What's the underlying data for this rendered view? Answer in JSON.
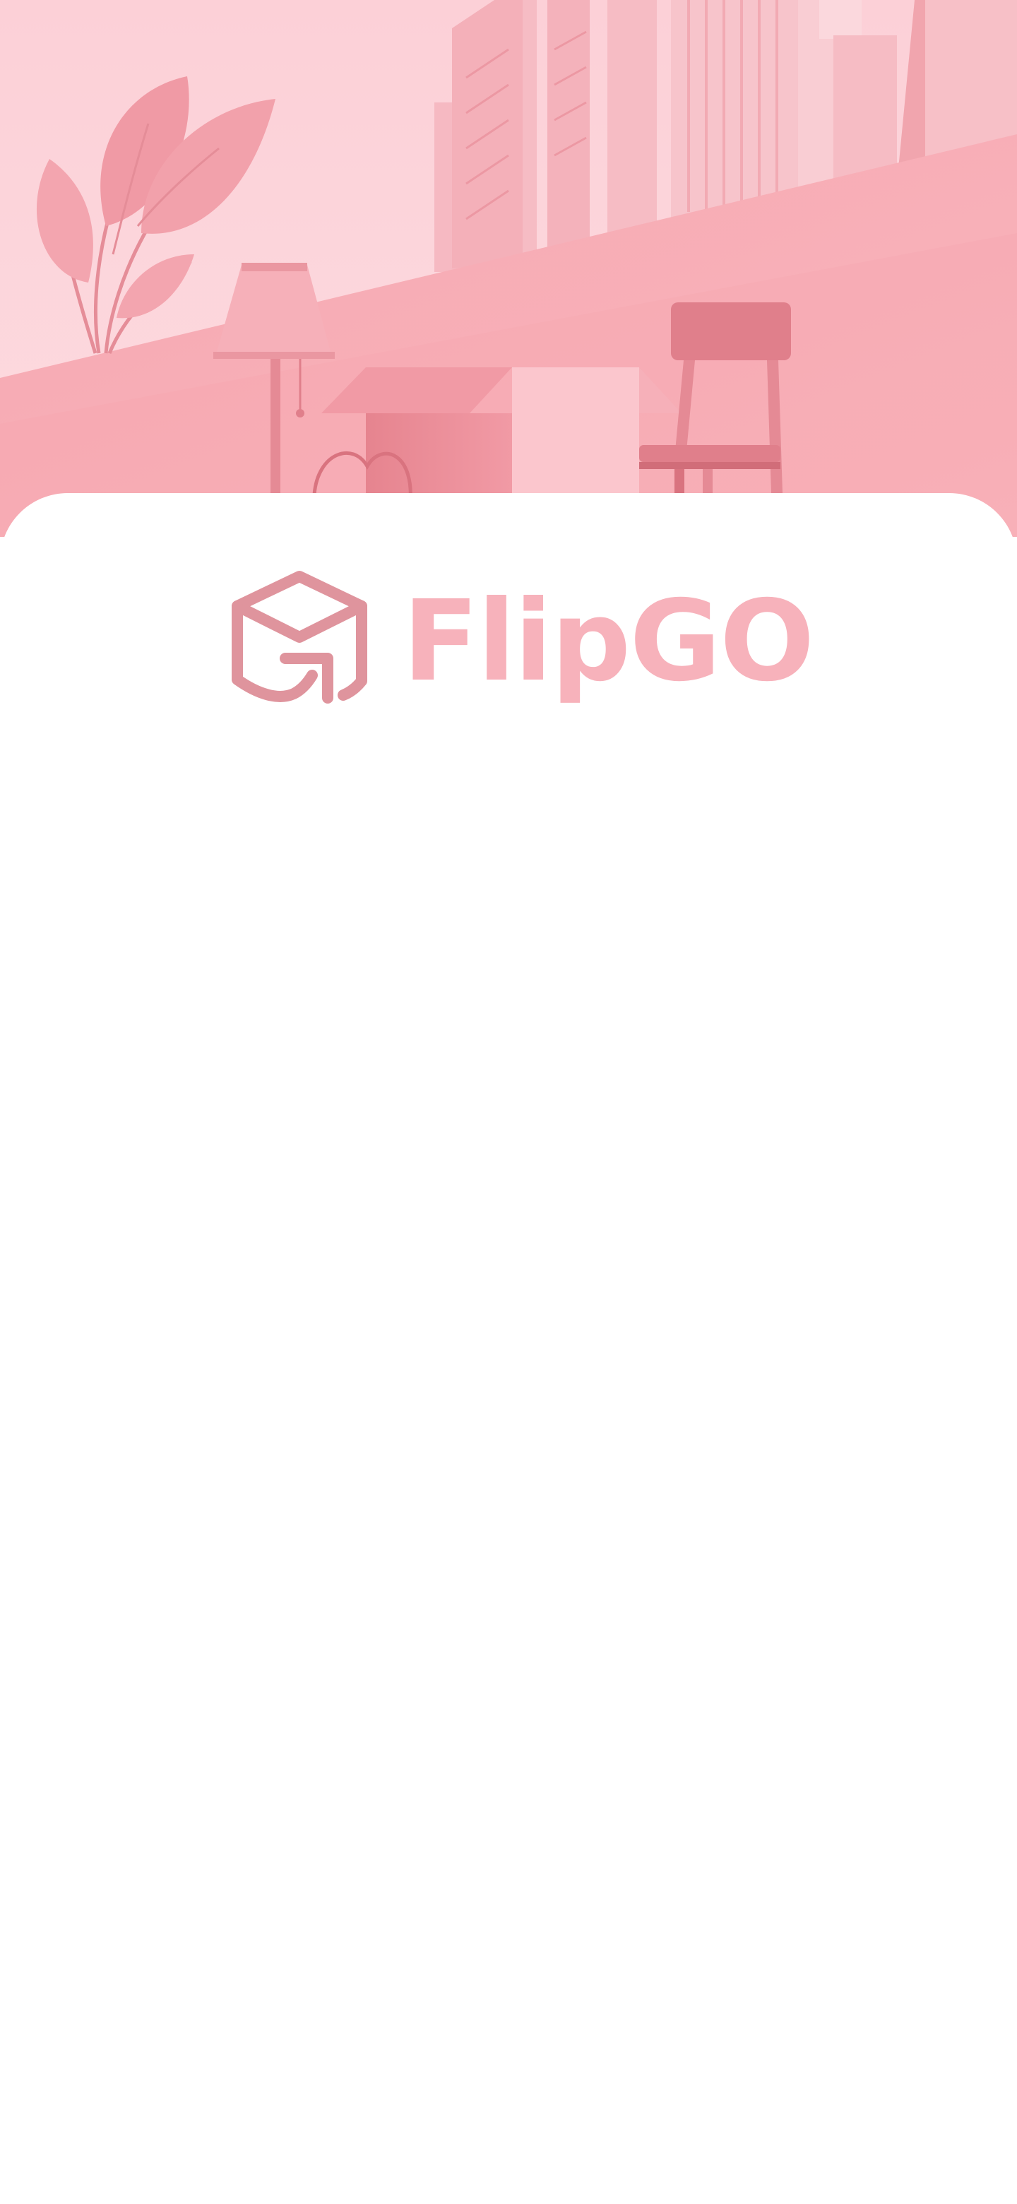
{
  "brand": {
    "name": "FlipGO",
    "logo_icon": "box-arrow-icon",
    "name_color": "#f7b2bb",
    "icon_color": "#df949d"
  },
  "hero": {
    "illustration": "pink-moving-scene-illustration",
    "palette": {
      "sky": "#fdd3da",
      "ground": "#f7abb4",
      "buildings": "#f8c0c8",
      "accent": "#e07f8b"
    }
  }
}
